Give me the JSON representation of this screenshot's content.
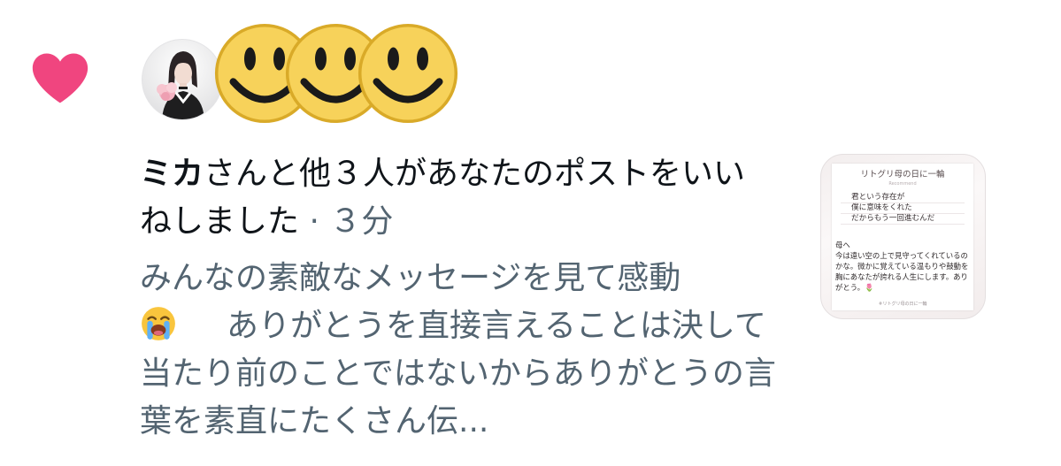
{
  "colors": {
    "heart": "#f0457f",
    "primary_text": "#0f1419",
    "secondary_text": "#536471",
    "smiley_yellow": "#f7d25a"
  },
  "icons": {
    "like": "heart-icon",
    "avatar_reactions": [
      "smiley-face-icon",
      "smiley-face-icon",
      "smiley-face-icon"
    ],
    "inline_emoji": "loudly-crying-face-emoji"
  },
  "notification": {
    "actor_name": "ミカ",
    "action_text": "さんと他３人があなたのポストをいいねしました",
    "separator": " · ",
    "time": "３分"
  },
  "post_preview": {
    "text_part1": "みんなの素敵なメッセージを見て感動",
    "text_part2": "ありがとうを直接言えることは決して当たり前のことではないからありがとうの言葉を素直にたくさん伝..."
  },
  "thumbnail": {
    "title": "リトグリ母の日に一輪",
    "subtitle": "Recommend",
    "poem": "君という存在が\n僕に意味をくれた\nだからもう一回進むんだ",
    "letter": "母へ\n今は遠い空の上で見守ってくれているのかな。微かに覚えている温もりや鼓動を胸にあなたが誇れる人生にします。ありがとう。🌷",
    "footer": "＃リトグリ母の日に一輪"
  }
}
